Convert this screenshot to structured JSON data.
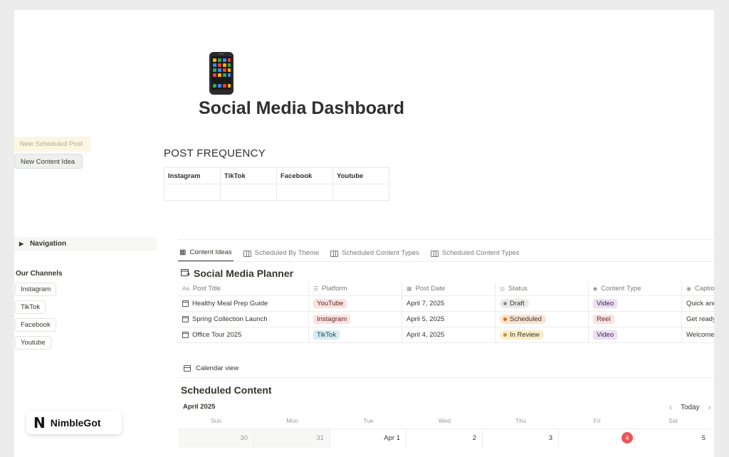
{
  "page": {
    "icon": "mobile-phone-icon",
    "title": "Social Media Dashboard"
  },
  "buttons": {
    "new_scheduled_post": "New Scheduled Post",
    "new_content_idea": "New Content Idea"
  },
  "post_frequency": {
    "heading": "POST FREQUENCY",
    "columns": [
      "Instagram",
      "TikTok",
      "Facebook",
      "Youtube"
    ]
  },
  "sidebar": {
    "navigation": "Navigation",
    "channels_heading": "Our Channels",
    "channels": [
      "Instagram",
      "TikTok",
      "Facebook",
      "Youtube"
    ]
  },
  "tabs": [
    {
      "label": "Content Ideas",
      "active": true
    },
    {
      "label": "Scheduled By Theme",
      "active": false
    },
    {
      "label": "Scheduled Content Types",
      "active": false
    },
    {
      "label": "Scheduled Content Types",
      "active": false
    }
  ],
  "planner": {
    "title": "Social Media Planner",
    "columns": [
      "Post Title",
      "Platform",
      "Post Date",
      "Status",
      "Content Type",
      "Captio"
    ],
    "rows": [
      {
        "title": "Healthy Meal Prep Guide",
        "platform": "YouTube",
        "date": "April 7, 2025",
        "status": "Draft",
        "type": "Video",
        "caption": "Quick and"
      },
      {
        "title": "Spring Collection Launch",
        "platform": "Instagram",
        "date": "April 5, 2025",
        "status": "Scheduled",
        "type": "Reel",
        "caption": "Get ready"
      },
      {
        "title": "Office Tour 2025",
        "platform": "TikTok",
        "date": "April 4, 2025",
        "status": "In Review",
        "type": "Video",
        "caption": "Welcome"
      }
    ]
  },
  "calendar": {
    "view_label": "Calendar view",
    "title": "Scheduled Content",
    "month": "April 2025",
    "today_label": "Today",
    "weekdays": [
      "Sun",
      "Mon",
      "Tue",
      "Wed",
      "Thu",
      "Fri",
      "Sat"
    ],
    "dates": [
      "30",
      "31",
      "Apr 1",
      "2",
      "3",
      "4",
      "5"
    ]
  },
  "badge": {
    "logo_letter": "N",
    "name": "NimbleGot"
  },
  "colors": {
    "youtube_bg": "#fbe2e0",
    "youtube_fg": "#5c2b28",
    "instagram_bg": "#fbe2e0",
    "instagram_fg": "#5c2b28",
    "tiktok_bg": "#d8ebf3",
    "tiktok_fg": "#1e4a5c",
    "draft_bg": "#ebebea",
    "draft_dot": "#8e8d89",
    "scheduled_bg": "#fbe2d1",
    "scheduled_dot": "#d9730d",
    "review_bg": "#fbedc9",
    "review_dot": "#cb912f",
    "video_bg": "#eadff3",
    "reel_bg": "#fbe2e0",
    "today_red": "#eb5757"
  }
}
